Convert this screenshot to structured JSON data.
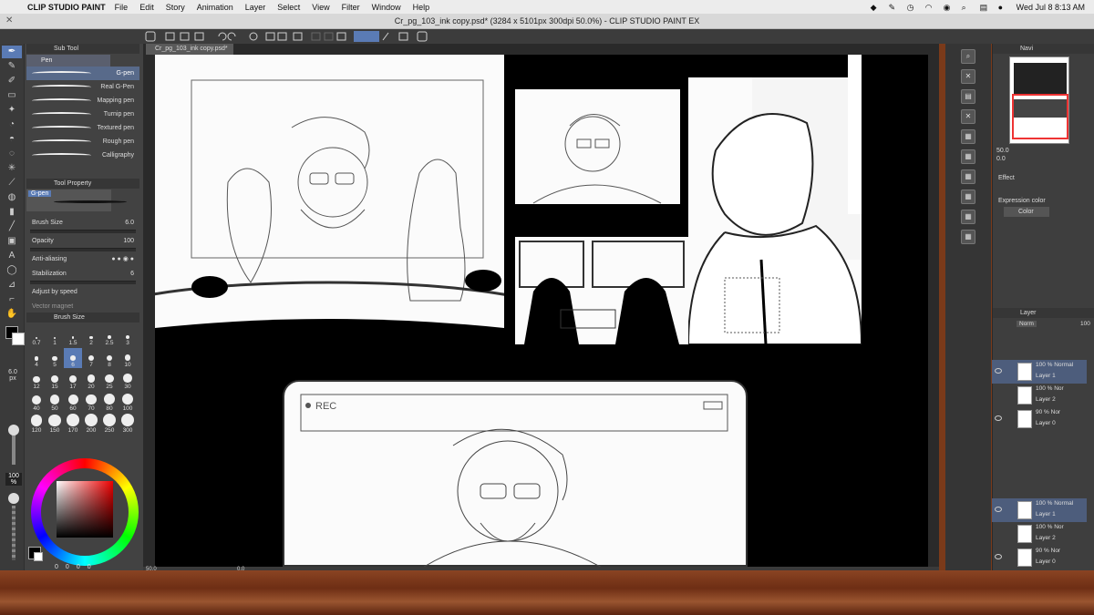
{
  "menubar": {
    "app_name": "CLIP STUDIO PAINT",
    "items": [
      "File",
      "Edit",
      "Story",
      "Animation",
      "Layer",
      "Select",
      "View",
      "Filter",
      "Window",
      "Help"
    ],
    "clock": "Wed Jul 8  8:13 AM"
  },
  "window": {
    "title": "Cr_pg_103_ink copy.psd* (3284 x 5101px 300dpi 50.0%) - CLIP STUDIO PAINT EX",
    "doc_tab": "Cr_pg_103_ink copy.psd*"
  },
  "sub_tool": {
    "header": "Sub Tool",
    "tab": "Pen",
    "brushes": [
      "G-pen",
      "Real G-Pen",
      "Mapping pen",
      "Turnip pen",
      "Textured pen",
      "Rough pen",
      "Calligraphy"
    ],
    "selected_index": 0
  },
  "tool_property": {
    "header": "Tool Property",
    "preset_name": "G-pen",
    "brush_size_label": "Brush Size",
    "brush_size_value": "6.0",
    "opacity_label": "Opacity",
    "opacity_value": "100",
    "anti_aliasing_label": "Anti-aliasing",
    "stabilization_label": "Stabilization",
    "stabilization_value": "6",
    "adjust_by_speed_label": "Adjust by speed",
    "vector_magnet_label": "Vector magnet"
  },
  "brush_size_panel": {
    "header": "Brush Size",
    "sizes": [
      "0.7",
      "1",
      "1.5",
      "2",
      "2.5",
      "3",
      "4",
      "5",
      "6",
      "7",
      "8",
      "10",
      "12",
      "15",
      "17",
      "20",
      "25",
      "30",
      "40",
      "50",
      "60",
      "70",
      "80",
      "100",
      "120",
      "150",
      "170",
      "200",
      "250",
      "300"
    ],
    "selected": "6",
    "current_size": "6.0",
    "unit": "px"
  },
  "left_opacity": "100\n%",
  "color_counts": [
    "0",
    "0",
    "0",
    "0"
  ],
  "status_bar": {
    "zoom": "50.0",
    "rotation": "0.0"
  },
  "navigator": {
    "header": "Navi",
    "zoom_value": "50.0",
    "angle_value": "0.0"
  },
  "effect": {
    "header": "Effect",
    "expression_color_label": "Expression color",
    "expression_color_value": "Color"
  },
  "layer_panel": {
    "header": "Layer",
    "blend_mode": "Norm",
    "opacity": "100",
    "layers_top": [
      {
        "mode": "100 % Normal",
        "name": "Layer 1",
        "selected": true
      },
      {
        "mode": "100 % Nor",
        "name": "Layer 2",
        "selected": false
      },
      {
        "mode": "90 % Nor",
        "name": "Layer 0",
        "selected": false
      }
    ],
    "layers_bottom": [
      {
        "mode": "100 % Normal",
        "name": "Layer 1",
        "selected": true
      },
      {
        "mode": "100 % Nor",
        "name": "Layer 2",
        "selected": false
      },
      {
        "mode": "90 % Nor",
        "name": "Layer 0",
        "selected": false
      }
    ]
  },
  "canvas_text": {
    "rec_label": "REC"
  },
  "colors": {
    "accent": "#5a7bb5",
    "panel_bg": "#424242",
    "menubar_bg": "#ececec"
  }
}
